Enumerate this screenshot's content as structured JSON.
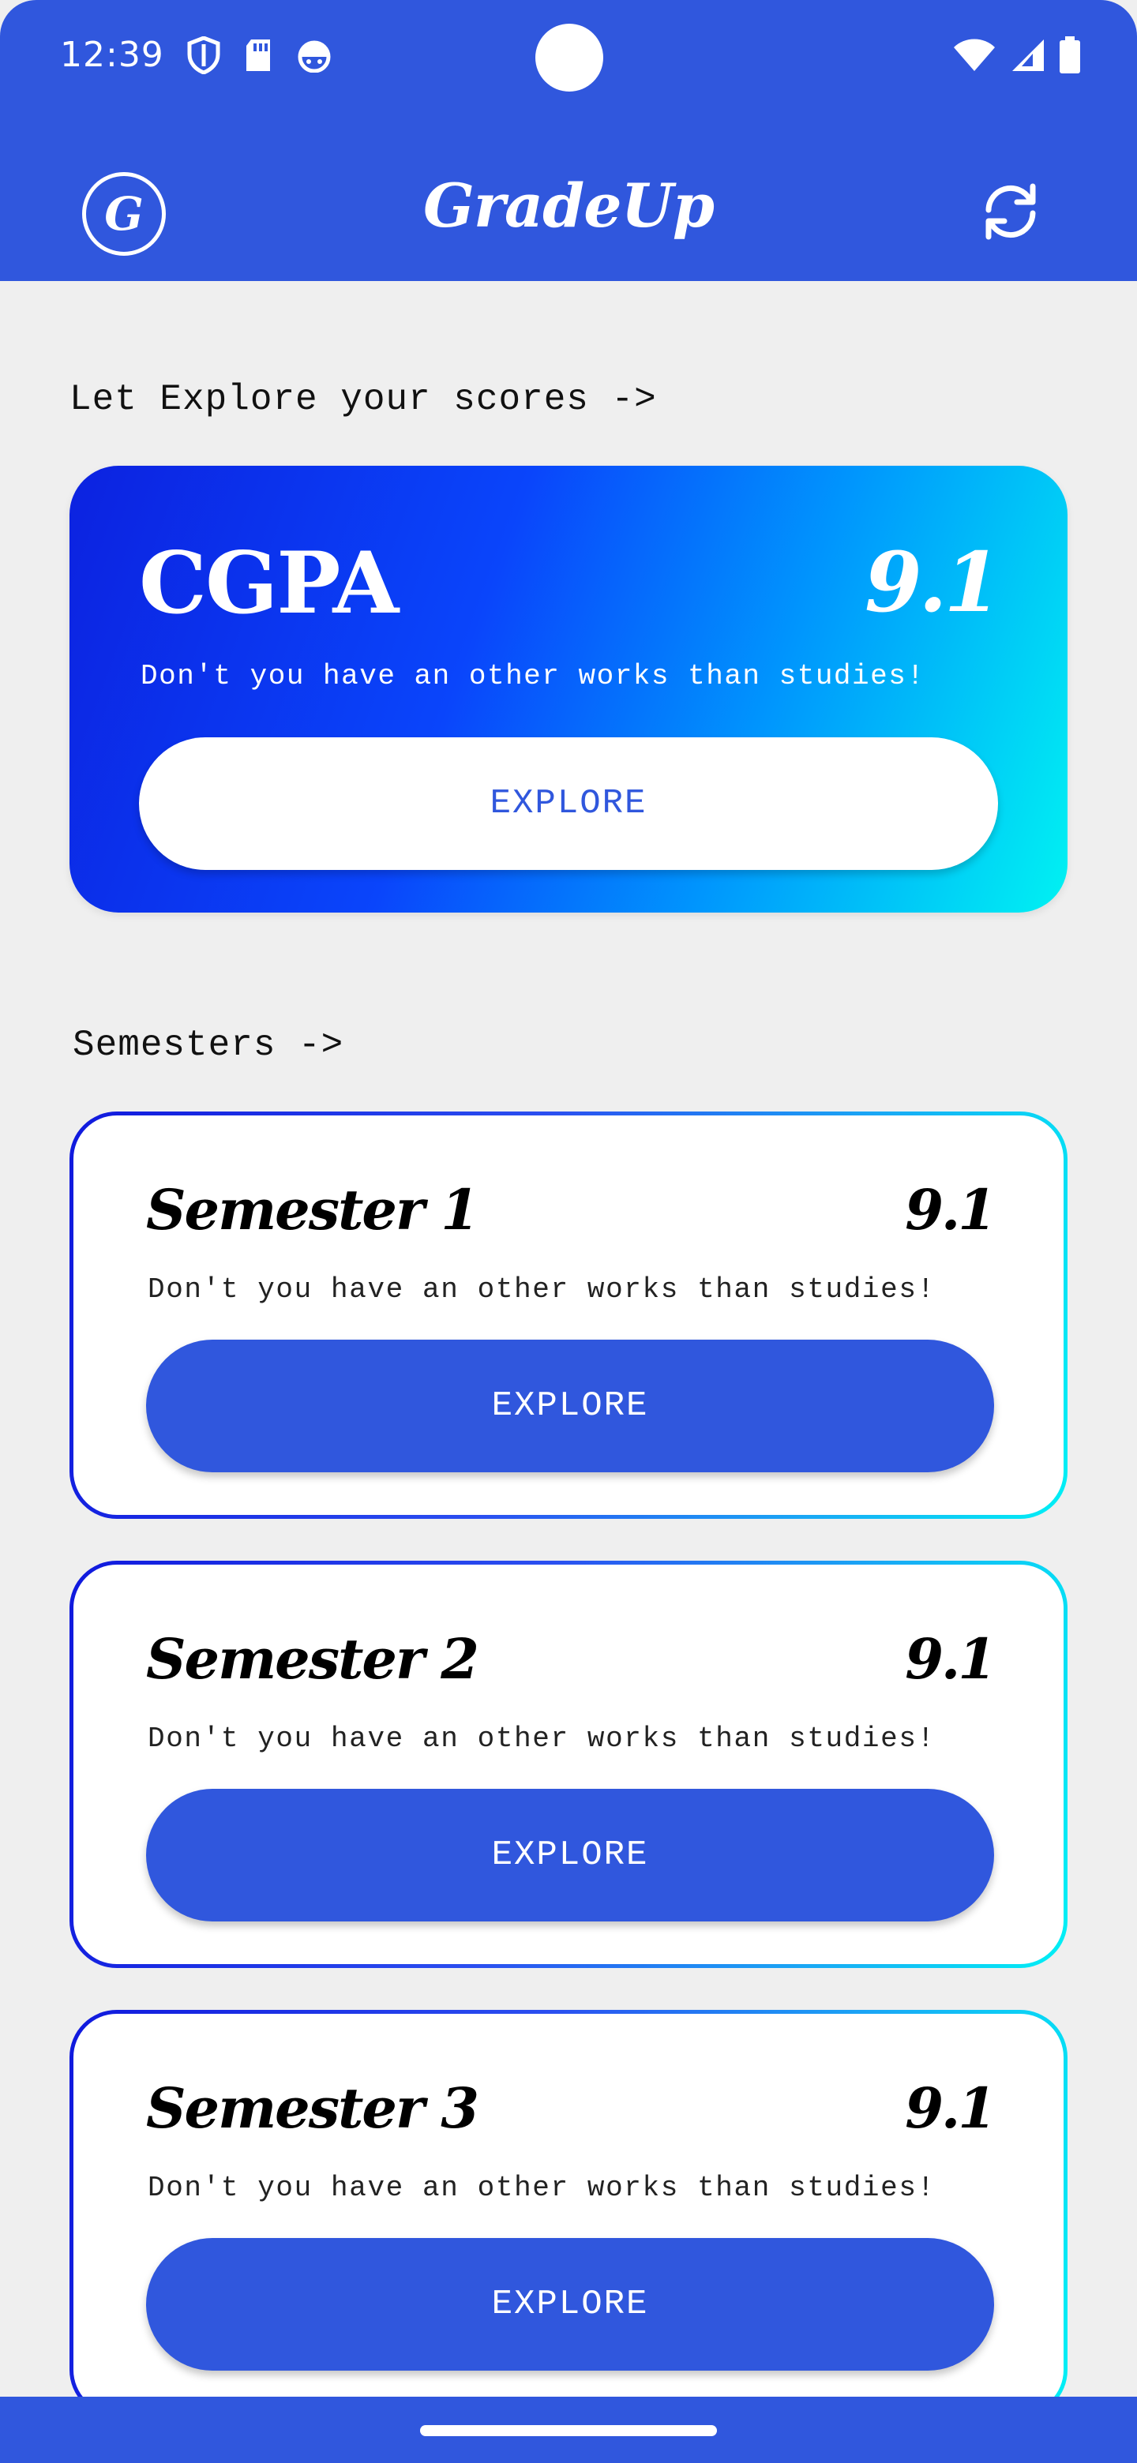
{
  "status_bar": {
    "time": "12:39",
    "left_icons": [
      "shield-icon",
      "sd-card-icon",
      "android-debug-icon"
    ],
    "right_icons": [
      "wifi-icon",
      "signal-icon",
      "battery-icon"
    ]
  },
  "app_bar": {
    "logo_letter": "G",
    "title": "GradeUp",
    "refresh_icon": "refresh-icon"
  },
  "intro": {
    "label": "Let Explore your scores ->"
  },
  "cgpa_card": {
    "title": "CGPA",
    "value": "9.1",
    "subtitle": "Don't you have an other works than studies!",
    "button_label": "EXPLORE"
  },
  "semesters_section": {
    "label": "Semesters ->",
    "items": [
      {
        "title": "Semester 1",
        "value": "9.1",
        "subtitle": "Don't you have an other works than studies!",
        "button_label": "EXPLORE"
      },
      {
        "title": "Semester 2",
        "value": "9.1",
        "subtitle": "Don't you have an other works than studies!",
        "button_label": "EXPLORE"
      },
      {
        "title": "Semester 3",
        "value": "9.1",
        "subtitle": "Don't you have an other works than studies!",
        "button_label": "EXPLORE"
      }
    ]
  },
  "colors": {
    "primary": "#3057dd",
    "background": "#efefef",
    "gradient_start": "#0c22e0",
    "gradient_end": "#00f2f2"
  }
}
